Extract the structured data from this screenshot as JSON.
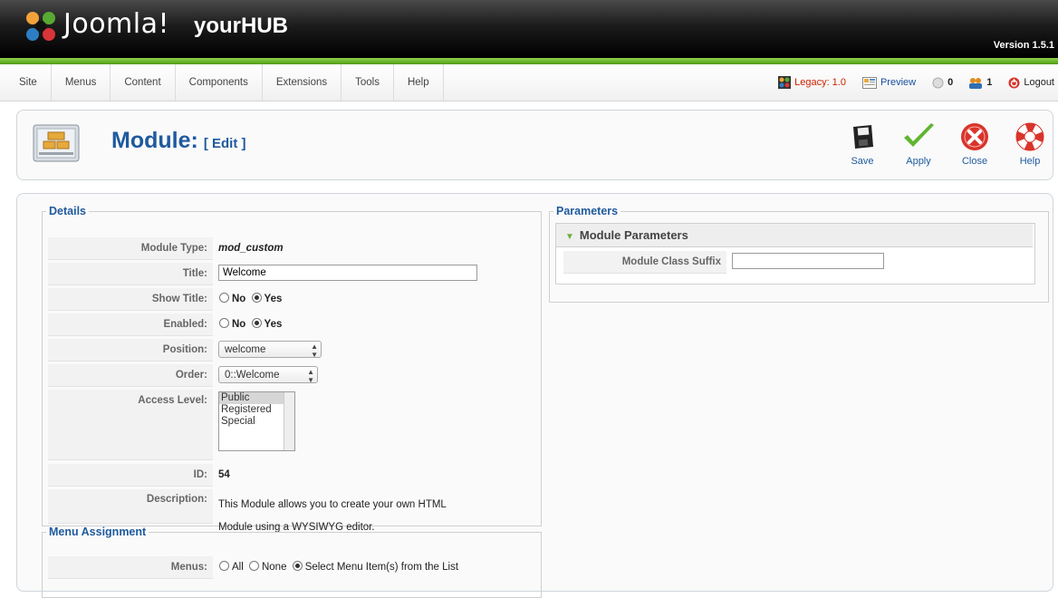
{
  "header": {
    "brand": "Joomla!",
    "site_name": "yourHUB",
    "version": "Version 1.5.1"
  },
  "menu": {
    "items": [
      "Site",
      "Menus",
      "Content",
      "Components",
      "Extensions",
      "Tools",
      "Help"
    ]
  },
  "status": {
    "legacy": "Legacy: 1.0",
    "preview": "Preview",
    "messages_count": "0",
    "users_count": "1",
    "logout": "Logout"
  },
  "toolbar": {
    "title": "Module:",
    "subtitle": "[ Edit ]",
    "buttons": {
      "save": "Save",
      "apply": "Apply",
      "close": "Close",
      "help": "Help"
    }
  },
  "details": {
    "legend": "Details",
    "module_type_label": "Module Type:",
    "module_type": "mod_custom",
    "title_label": "Title:",
    "title_value": "Welcome",
    "show_title_label": "Show Title:",
    "enabled_label": "Enabled:",
    "no_label": "No",
    "yes_label": "Yes",
    "show_title_value": "Yes",
    "enabled_value": "Yes",
    "position_label": "Position:",
    "position_value": "welcome",
    "order_label": "Order:",
    "order_value": "0::Welcome",
    "access_label": "Access Level:",
    "access_options": [
      "Public",
      "Registered",
      "Special"
    ],
    "access_selected": "Public",
    "id_label": "ID:",
    "id_value": "54",
    "description_label": "Description:",
    "description_line1": "This Module allows you to create your own HTML",
    "description_line2": "Module using a WYSIWYG editor."
  },
  "menu_assignment": {
    "legend": "Menu Assignment",
    "menus_label": "Menus:",
    "opt_all": "All",
    "opt_none": "None",
    "opt_select": "Select Menu Item(s) from the List",
    "selected": "Select Menu Item(s) from the List"
  },
  "parameters": {
    "legend": "Parameters",
    "panel_title": "Module Parameters",
    "class_suffix_label": "Module Class Suffix",
    "class_suffix_value": ""
  },
  "colors": {
    "accent_blue": "#1f5a9e",
    "header_green": "#6ab42f",
    "close_red": "#d9342b"
  }
}
